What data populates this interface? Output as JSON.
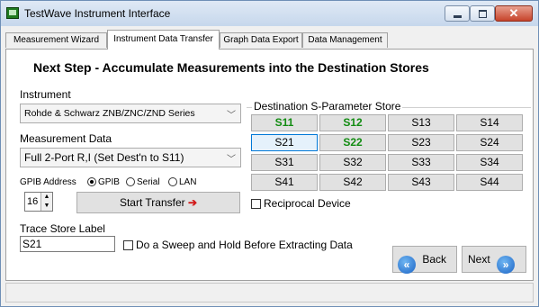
{
  "window": {
    "title": "TestWave Instrument Interface",
    "close_glyph": "✕"
  },
  "tabs": [
    {
      "label": "Measurement Wizard"
    },
    {
      "label": "Instrument Data Transfer"
    },
    {
      "label": "Graph Data Export"
    },
    {
      "label": "Data Management"
    }
  ],
  "heading": "Next Step - Accumulate Measurements into the Destination Stores",
  "instrument": {
    "label": "Instrument",
    "value": "Rohde & Schwarz ZNB/ZNC/ZND Series"
  },
  "measurement_data": {
    "label": "Measurement Data",
    "value": "Full 2-Port R,I (Set Dest'n to S11)"
  },
  "gpib": {
    "label": "GPIB Address",
    "options": [
      "GPIB",
      "Serial",
      "LAN"
    ],
    "selected": "GPIB",
    "address": "16"
  },
  "start_transfer": {
    "label": "Start Transfer",
    "arrow": "➔"
  },
  "destination": {
    "title": "Destination S-Parameter Store",
    "buttons": [
      {
        "label": "S11",
        "style": "green"
      },
      {
        "label": "S12",
        "style": "green"
      },
      {
        "label": "S13",
        "style": "normal"
      },
      {
        "label": "S14",
        "style": "normal"
      },
      {
        "label": "S21",
        "style": "selected"
      },
      {
        "label": "S22",
        "style": "green"
      },
      {
        "label": "S23",
        "style": "normal"
      },
      {
        "label": "S24",
        "style": "normal"
      },
      {
        "label": "S31",
        "style": "normal"
      },
      {
        "label": "S32",
        "style": "normal"
      },
      {
        "label": "S33",
        "style": "normal"
      },
      {
        "label": "S34",
        "style": "normal"
      },
      {
        "label": "S41",
        "style": "normal"
      },
      {
        "label": "S42",
        "style": "normal"
      },
      {
        "label": "S43",
        "style": "normal"
      },
      {
        "label": "S44",
        "style": "normal"
      }
    ],
    "reciprocal_label": "Reciprocal Device"
  },
  "trace_store": {
    "label": "Trace Store Label",
    "value": "S21"
  },
  "sweep_hold": {
    "label": "Do a Sweep and Hold Before Extracting Data"
  },
  "nav": {
    "back_label": "Back",
    "next_label": "Next",
    "back_icon": "«",
    "next_icon": "»"
  },
  "colors": {
    "green_text": "#128c12",
    "selected_border": "#0078d7",
    "arrow_red": "#d21a1a"
  }
}
